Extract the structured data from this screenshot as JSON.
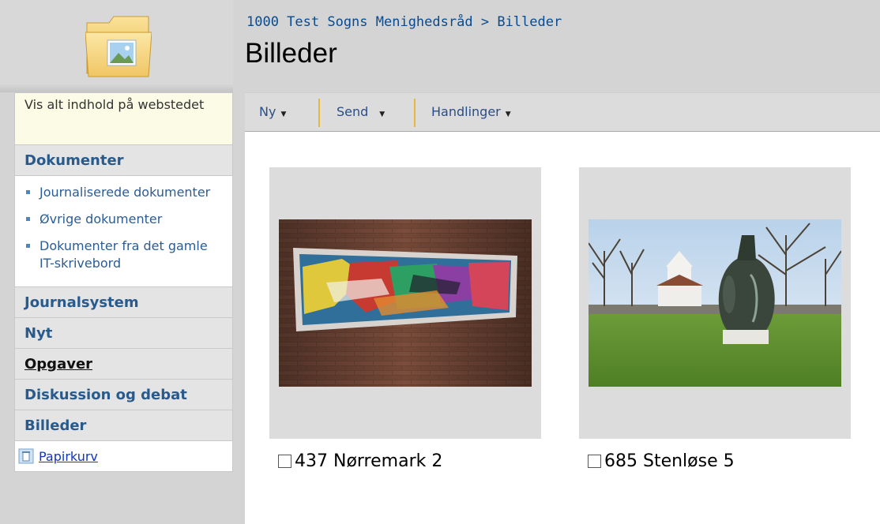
{
  "header": {
    "breadcrumb_parent": "1000 Test Sogns Menighedsråd",
    "breadcrumb_separator": ">",
    "breadcrumb_current": "Billeder",
    "title": "Billeder",
    "icon": "pictures-folder-icon"
  },
  "sidebar": {
    "view_all": "Vis alt indhold på webstedet",
    "sections": {
      "documents": "Dokumenter",
      "journal": "Journalsystem",
      "news": "Nyt",
      "tasks": "Opgaver",
      "discussion": "Diskussion og debat",
      "pictures": "Billeder"
    },
    "document_items": [
      "Journaliserede dokumenter",
      "Øvrige dokumenter",
      "Dokumenter fra det gamle IT-skrivebord"
    ],
    "recycle_bin": "Papirkurv"
  },
  "toolbar": {
    "new_label": "Ny",
    "send_label": "Send",
    "actions_label": "Handlinger"
  },
  "pictures": [
    {
      "title": "437 Nørremark 2"
    },
    {
      "title": "685 Stenløse 5"
    }
  ],
  "colors": {
    "header_bg": "#d4d4d4",
    "link_blue": "#2b5c93",
    "toolbar_separator": "#e8b83d"
  }
}
